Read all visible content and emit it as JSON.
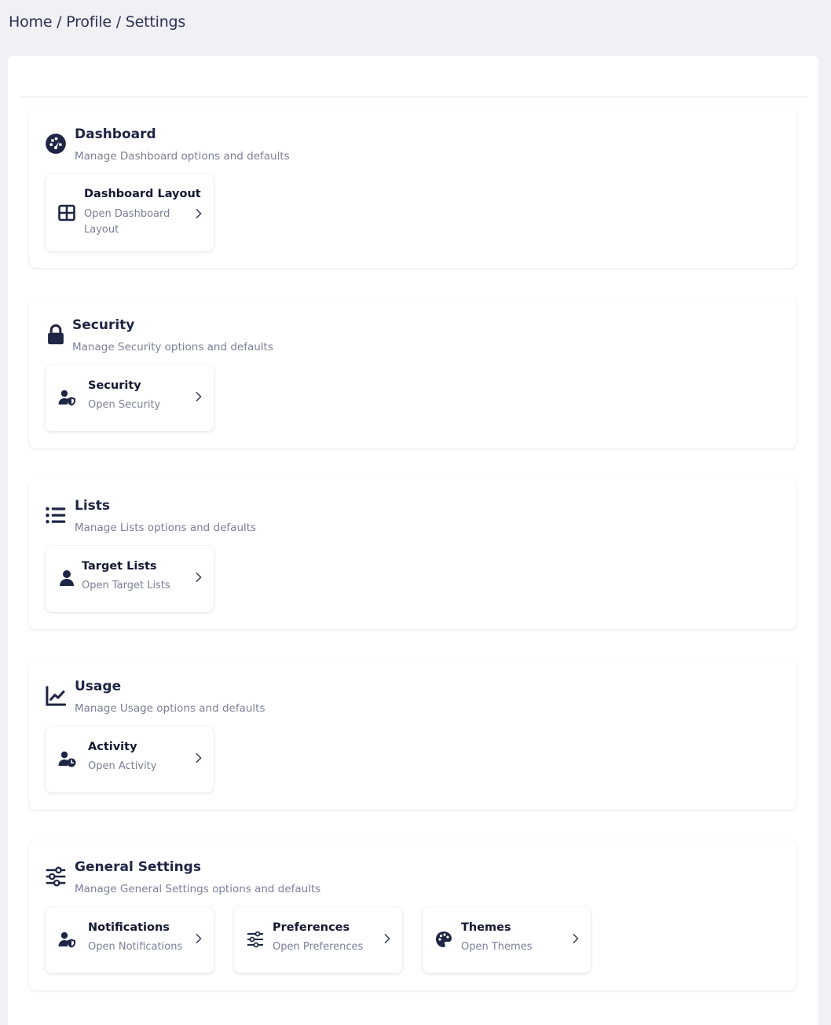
{
  "breadcrumb": {
    "home": "Home",
    "sep1": "/",
    "profile": "Profile",
    "sep2": "/",
    "settings": "Settings"
  },
  "colors": {
    "page_bg": "#f0f0f5",
    "panel_bg": "#ffffff",
    "text_primary": "#1f2544",
    "text_muted": "#7a7f99"
  },
  "sections": [
    {
      "icon": "gauge-icon",
      "title": "Dashboard",
      "description": "Manage Dashboard options and defaults",
      "cards": [
        {
          "icon": "grid-layout-icon",
          "title": "Dashboard Layout",
          "subtitle_line1": "Open Dashboard",
          "subtitle_line2": "Layout"
        }
      ]
    },
    {
      "icon": "lock-icon",
      "title": "Security",
      "description": "Manage Security options and defaults",
      "cards": [
        {
          "icon": "user-shield-icon",
          "title": "Security",
          "subtitle": "Open Security"
        }
      ]
    },
    {
      "icon": "list-icon",
      "title": "Lists",
      "description": "Manage Lists options and defaults",
      "cards": [
        {
          "icon": "user-icon",
          "title": "Target Lists",
          "subtitle": "Open Target Lists"
        }
      ]
    },
    {
      "icon": "line-chart-icon",
      "title": "Usage",
      "description": "Manage Usage options and defaults",
      "cards": [
        {
          "icon": "user-clock-icon",
          "title": "Activity",
          "subtitle": "Open Activity"
        }
      ]
    },
    {
      "icon": "sliders-icon",
      "title": "General Settings",
      "description": "Manage General Settings options and defaults",
      "cards": [
        {
          "icon": "user-shield-icon",
          "title": "Notifications",
          "subtitle": "Open Notifications"
        },
        {
          "icon": "sliders-icon",
          "title": "Preferences",
          "subtitle": "Open Preferences"
        },
        {
          "icon": "palette-icon",
          "title": "Themes",
          "subtitle": "Open Themes"
        }
      ]
    }
  ]
}
